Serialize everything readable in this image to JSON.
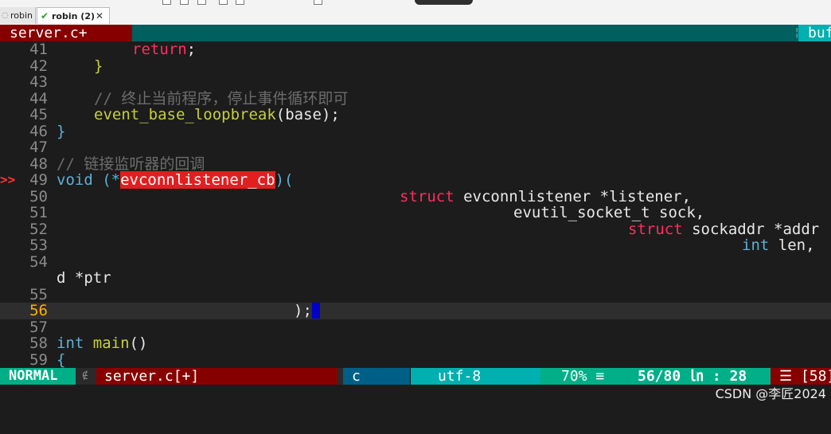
{
  "tabs": [
    {
      "label": "robin",
      "icon": "refresh-icon"
    },
    {
      "label": "robin (2)",
      "icon": "check-icon",
      "close": "✕"
    }
  ],
  "bufferline": {
    "active": "server.c+",
    "separator": "¦",
    "right": "buf"
  },
  "code": {
    "lines": [
      {
        "num": "41",
        "sign": ""
      },
      {
        "num": "42",
        "sign": ""
      },
      {
        "num": "43",
        "sign": ""
      },
      {
        "num": "44",
        "sign": ""
      },
      {
        "num": "45",
        "sign": ""
      },
      {
        "num": "46",
        "sign": ""
      },
      {
        "num": "47",
        "sign": ""
      },
      {
        "num": "48",
        "sign": ""
      },
      {
        "num": "49",
        "sign": ">>"
      },
      {
        "num": "50",
        "sign": ""
      },
      {
        "num": "51",
        "sign": ""
      },
      {
        "num": "52",
        "sign": ""
      },
      {
        "num": "53",
        "sign": ""
      },
      {
        "num": "54",
        "sign": ""
      },
      {
        "num": "55",
        "sign": ""
      },
      {
        "num": "56",
        "sign": ""
      },
      {
        "num": "57",
        "sign": ""
      },
      {
        "num": "58",
        "sign": ""
      },
      {
        "num": "59",
        "sign": ""
      }
    ],
    "tokens": {
      "l41_return": "return",
      "l41_semi": ";",
      "l42_brace": "}",
      "l44_comment": "// 终止当前程序，停止事件循环即可",
      "l45_func": "event_base_loopbreak",
      "l45_rest": "(base);",
      "l46_brace": "}",
      "l48_comment": "// 链接监听器的回调",
      "l49_void": "void",
      "l49_open": " (*",
      "l49_name": "evconnlistener_cb",
      "l49_close": ")(",
      "l50_struct": "struct",
      "l50_rest": " evconnlistener *listener,",
      "l51_text": "evutil_socket_t sock,",
      "l52_struct": "struct",
      "l52_rest": " sockaddr *addr",
      "l53_int": "int",
      "l53_rest": " len,",
      "l54_wrap": "d *ptr",
      "l56_text": ");",
      "l58_int": "int",
      "l58_func": "main",
      "l58_rest": "()",
      "l59_brace": "{"
    }
  },
  "statusline": {
    "mode": "NORMAL",
    "branch_glyph": "∉",
    "file": "server.c[+]",
    "filetype": "c",
    "encoding": "utf-8",
    "percent": "70% ≡",
    "position": "56/80 ㏑ :  28",
    "warning_sep": "ⵑ",
    "warning": "☰ [58]"
  },
  "watermark": "CSDN @李匠2024",
  "colors": {
    "background": "#1c1c1c",
    "keyword": "#ff2d5f",
    "type": "#5fafd7",
    "function": "#c6cf3a",
    "comment": "#6c6c6c",
    "highlight": "#e21e1e",
    "mode_bg": "#00af87",
    "buffer_active_bg": "#870000"
  }
}
